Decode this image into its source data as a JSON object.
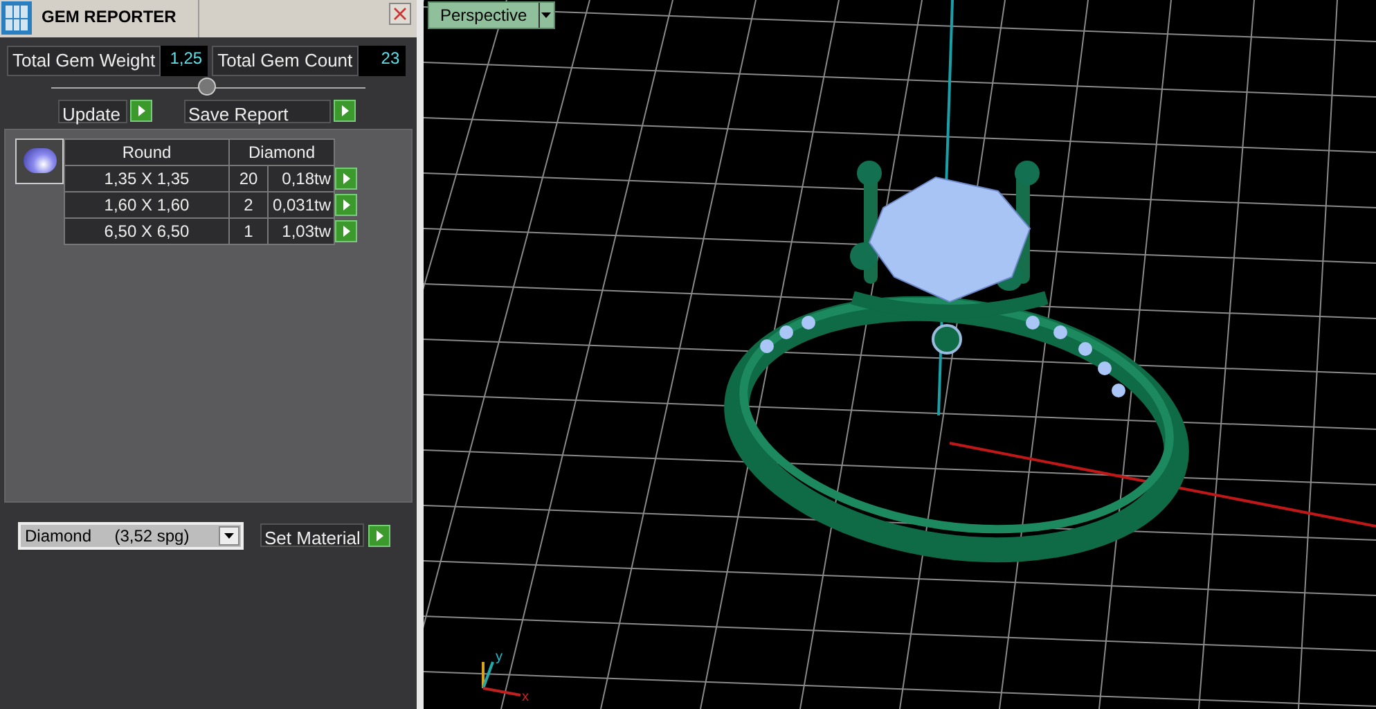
{
  "panel": {
    "title": "GEM REPORTER",
    "totals": [
      {
        "label": "Total Gem Weight",
        "value": "1,25"
      },
      {
        "label": "Total Gem Count",
        "value": "23"
      }
    ],
    "buttons": [
      "Update",
      "Save Report"
    ],
    "table": {
      "columns": [
        "Round",
        "Diamond"
      ],
      "rows": [
        {
          "size": "1,35 X 1,35",
          "count": "20",
          "weight": "0,18tw"
        },
        {
          "size": "1,60 X 1,60",
          "count": "2",
          "weight": "0,031tw"
        },
        {
          "size": "6,50 X 6,50",
          "count": "1",
          "weight": "1,03tw"
        }
      ]
    },
    "material": {
      "value": "Diamond     (3,52 spg)",
      "button": "Set Material"
    }
  },
  "viewport": {
    "view": "Perspective",
    "axis_labels": [
      "x",
      "y"
    ]
  }
}
